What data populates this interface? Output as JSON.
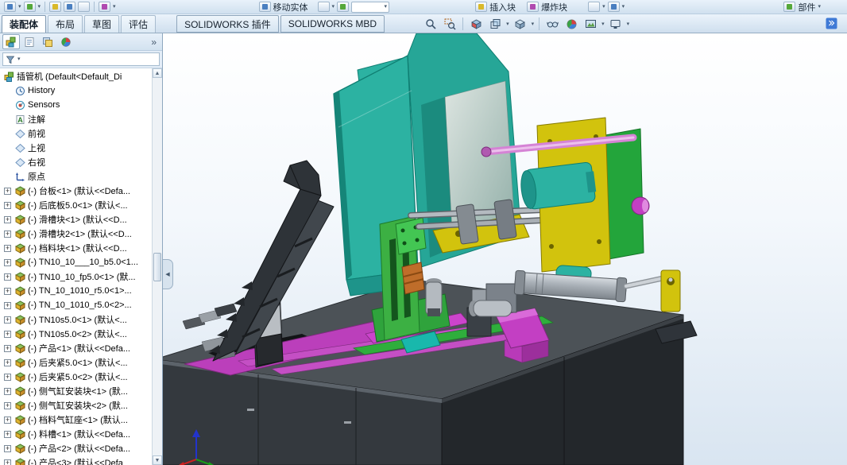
{
  "top_toolbar": {
    "labels": {
      "move_entity": "移动实体",
      "insert_block": "插入块",
      "explode_block": "爆炸块",
      "component": "部件"
    }
  },
  "command_tabs": {
    "items": [
      {
        "label": "装配体",
        "active": true
      },
      {
        "label": "布局",
        "active": false
      },
      {
        "label": "草图",
        "active": false
      },
      {
        "label": "评估",
        "active": false
      },
      {
        "label": "SOLIDWORKS 插件",
        "active": false
      },
      {
        "label": "SOLIDWORKS MBD",
        "active": false
      }
    ]
  },
  "view_toolbar_icons": [
    "zoom-fit",
    "zoom-area",
    "section-view",
    "view-orientation",
    "display-style",
    "hide-show-items",
    "edit-appearance",
    "apply-scene",
    "view-settings",
    "expand-commandmanager"
  ],
  "panel": {
    "tabs": [
      "feature-manager",
      "property-manager",
      "configuration-manager",
      "display-manager"
    ],
    "overflow_label": "»",
    "filter_placeholder": ""
  },
  "feature_tree": {
    "root": {
      "icon": "assembly",
      "label": "插管机 (Default<Default_Di",
      "expandable": false
    },
    "items": [
      {
        "icon": "history",
        "label": "History",
        "expandable": false
      },
      {
        "icon": "sensors",
        "label": "Sensors",
        "expandable": false
      },
      {
        "icon": "annotations",
        "label": "注解",
        "expandable": false
      },
      {
        "icon": "plane",
        "label": "前视",
        "expandable": false
      },
      {
        "icon": "plane",
        "label": "上视",
        "expandable": false
      },
      {
        "icon": "plane",
        "label": "右视",
        "expandable": false
      },
      {
        "icon": "origin",
        "label": "原点",
        "expandable": false
      },
      {
        "icon": "part",
        "label": "(-) 台板<1> (默认<<Defa...",
        "expandable": true
      },
      {
        "icon": "part",
        "label": "(-) 后底板5.0<1> (默认<...",
        "expandable": true
      },
      {
        "icon": "part",
        "label": "(-) 滑槽块<1> (默认<<D...",
        "expandable": true
      },
      {
        "icon": "part",
        "label": "(-) 滑槽块2<1> (默认<<D...",
        "expandable": true
      },
      {
        "icon": "part",
        "label": "(-) 档料块<1> (默认<<D...",
        "expandable": true
      },
      {
        "icon": "part",
        "label": "(-) TN10_10___10_b5.0<1...",
        "expandable": true
      },
      {
        "icon": "part",
        "label": "(-) TN10_10_fp5.0<1> (默...",
        "expandable": true
      },
      {
        "icon": "part",
        "label": "(-) TN_10_1010_r5.0<1>...",
        "expandable": true
      },
      {
        "icon": "part",
        "label": "(-) TN_10_1010_r5.0<2>...",
        "expandable": true
      },
      {
        "icon": "part",
        "label": "(-) TN10s5.0<1> (默认<...",
        "expandable": true
      },
      {
        "icon": "part",
        "label": "(-) TN10s5.0<2> (默认<...",
        "expandable": true
      },
      {
        "icon": "part",
        "label": "(-) 产品<1> (默认<<Defa...",
        "expandable": true
      },
      {
        "icon": "part",
        "label": "(-) 后夹紧5.0<1> (默认<...",
        "expandable": true
      },
      {
        "icon": "part",
        "label": "(-) 后夹紧5.0<2> (默认<...",
        "expandable": true
      },
      {
        "icon": "part",
        "label": "(-) 侧气缸安装块<1> (默...",
        "expandable": true
      },
      {
        "icon": "part",
        "label": "(-) 侧气缸安装块<2> (默...",
        "expandable": true
      },
      {
        "icon": "part",
        "label": "(-) 档料气缸座<1> (默认...",
        "expandable": true
      },
      {
        "icon": "part",
        "label": "(-) 料槽<1> (默认<<Defa...",
        "expandable": true
      },
      {
        "icon": "part",
        "label": "(-) 产品<2> (默认<<Defa...",
        "expandable": true
      },
      {
        "icon": "part",
        "label": "(-) 产品<3> (默认<<Defa",
        "expandable": true
      }
    ]
  },
  "viewport": {
    "colors": {
      "teal": "#2cb2a2",
      "yellow": "#d2c30d",
      "green": "#2fa33c",
      "magenta": "#c33fc3",
      "violet": "#bb3fbb",
      "pink": "#d583d5",
      "cabinet": "#34393e",
      "steel": "#a8aeb4",
      "arm": "#2e3338",
      "orange": "#bf6d2a",
      "triad_x": "#cc2222",
      "triad_y": "#18a018",
      "triad_z": "#2233cc"
    }
  }
}
